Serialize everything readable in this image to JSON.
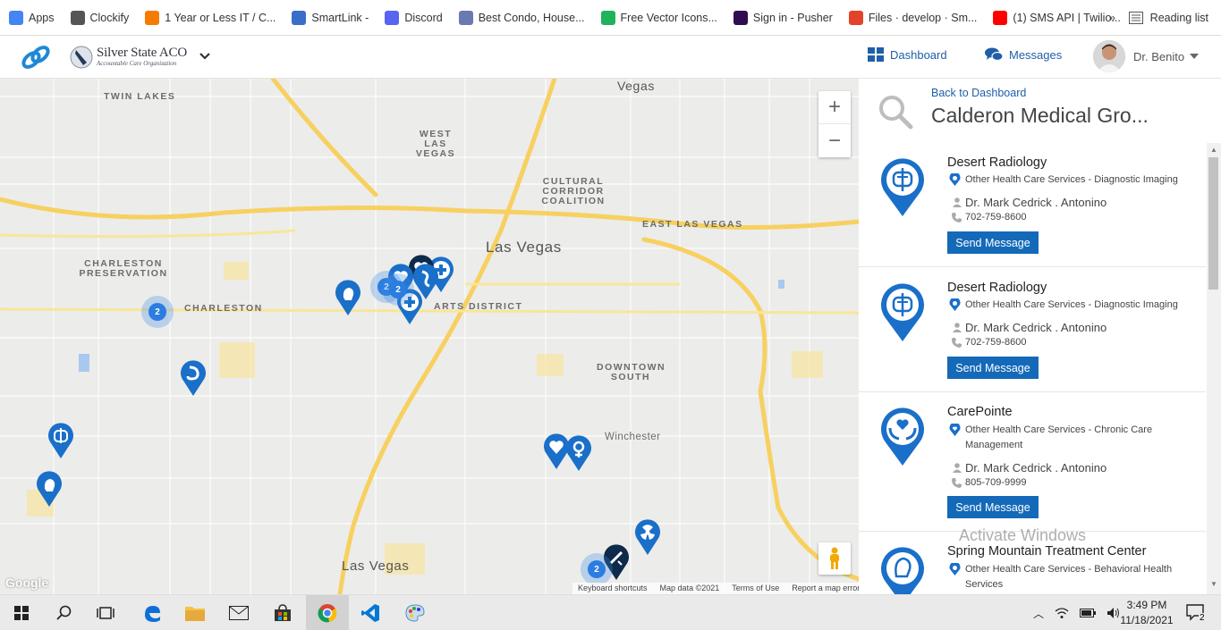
{
  "bookmarks": [
    {
      "label": "Apps",
      "icon": "apps-grid-icon",
      "color": "#4285f4"
    },
    {
      "label": "Clockify",
      "icon": "clockify-icon",
      "color": "#555555"
    },
    {
      "label": "1 Year or Less IT / C...",
      "icon": "m-logo-icon",
      "color": "#f57c00"
    },
    {
      "label": "SmartLink -",
      "icon": "link-icon",
      "color": "#3b6ec8"
    },
    {
      "label": "Discord",
      "icon": "discord-icon",
      "color": "#5865f2"
    },
    {
      "label": "Best Condo, House...",
      "icon": "condo-icon",
      "color": "#6a7ab0"
    },
    {
      "label": "Free Vector Icons...",
      "icon": "flaticon-icon",
      "color": "#1fb35a"
    },
    {
      "label": "Sign in - Pusher",
      "icon": "pusher-icon",
      "color": "#300d4f"
    },
    {
      "label": "Files · develop · Sm...",
      "icon": "gitlab-icon",
      "color": "#e24329"
    },
    {
      "label": "(1) SMS API | Twilio...",
      "icon": "youtube-icon",
      "color": "#ff0000"
    }
  ],
  "bookmarks_more": "»",
  "reading_list": "Reading list",
  "brand": {
    "name": "Silver State ACO",
    "tagline": "Accountable Care Organization"
  },
  "nav": {
    "dashboard": "Dashboard",
    "messages": "Messages",
    "user": "Dr. Benito"
  },
  "map": {
    "labels": [
      {
        "text": "TWIN LAKES"
      },
      {
        "text": "WEST LAS VEGAS"
      },
      {
        "text": "CULTURAL CORRIDOR COALITION"
      },
      {
        "text": "EAST LAS VEGAS"
      },
      {
        "text": "CHARLESTON PRESERVATION"
      },
      {
        "text": "CHARLESTON"
      },
      {
        "text": "ARTS DISTRICT"
      },
      {
        "text": "DOWNTOWN SOUTH"
      },
      {
        "text": "Winchester"
      }
    ],
    "cities": [
      "Las Vegas",
      "Vegas",
      "Las Vegas"
    ],
    "clusters": [
      "2",
      "2",
      "2",
      "2"
    ],
    "footer": [
      "Keyboard shortcuts",
      "Map data ©2021",
      "Terms of Use",
      "Report a map error"
    ],
    "google": "Google"
  },
  "panel": {
    "back_link": "Back to Dashboard",
    "title": "Calderon Medical Gro...",
    "send_label": "Send Message",
    "providers": [
      {
        "name": "Desert Radiology",
        "category": "Other Health Care Services - Diagnostic Imaging",
        "doctor": "Dr. Mark Cedrick . Antonino",
        "phone": "702-759-8600",
        "icon": "diagnostic-imaging-icon"
      },
      {
        "name": "Desert Radiology",
        "category": "Other Health Care Services - Diagnostic Imaging",
        "doctor": "Dr. Mark Cedrick . Antonino",
        "phone": "702-759-8600",
        "icon": "diagnostic-imaging-icon"
      },
      {
        "name": "CarePointe",
        "category": "Other Health Care Services - Chronic Care Management",
        "doctor": "Dr. Mark Cedrick . Antonino",
        "phone": "805-709-9999",
        "icon": "chronic-care-icon"
      },
      {
        "name": "Spring Mountain Treatment Center",
        "category": "Other Health Care Services - Behavioral Health Services",
        "doctor": "",
        "phone": "",
        "icon": "behavioral-health-icon"
      }
    ]
  },
  "watermark": {
    "line1": "Activate Windows"
  },
  "taskbar": {
    "time": "3:49 PM",
    "date": "11/18/2021",
    "notifications": "2"
  },
  "colors": {
    "pin_blue": "#1a6fc9",
    "pin_dark": "#0d2a4a",
    "accent": "#1469b8",
    "road_yellow": "#fcd34d"
  }
}
